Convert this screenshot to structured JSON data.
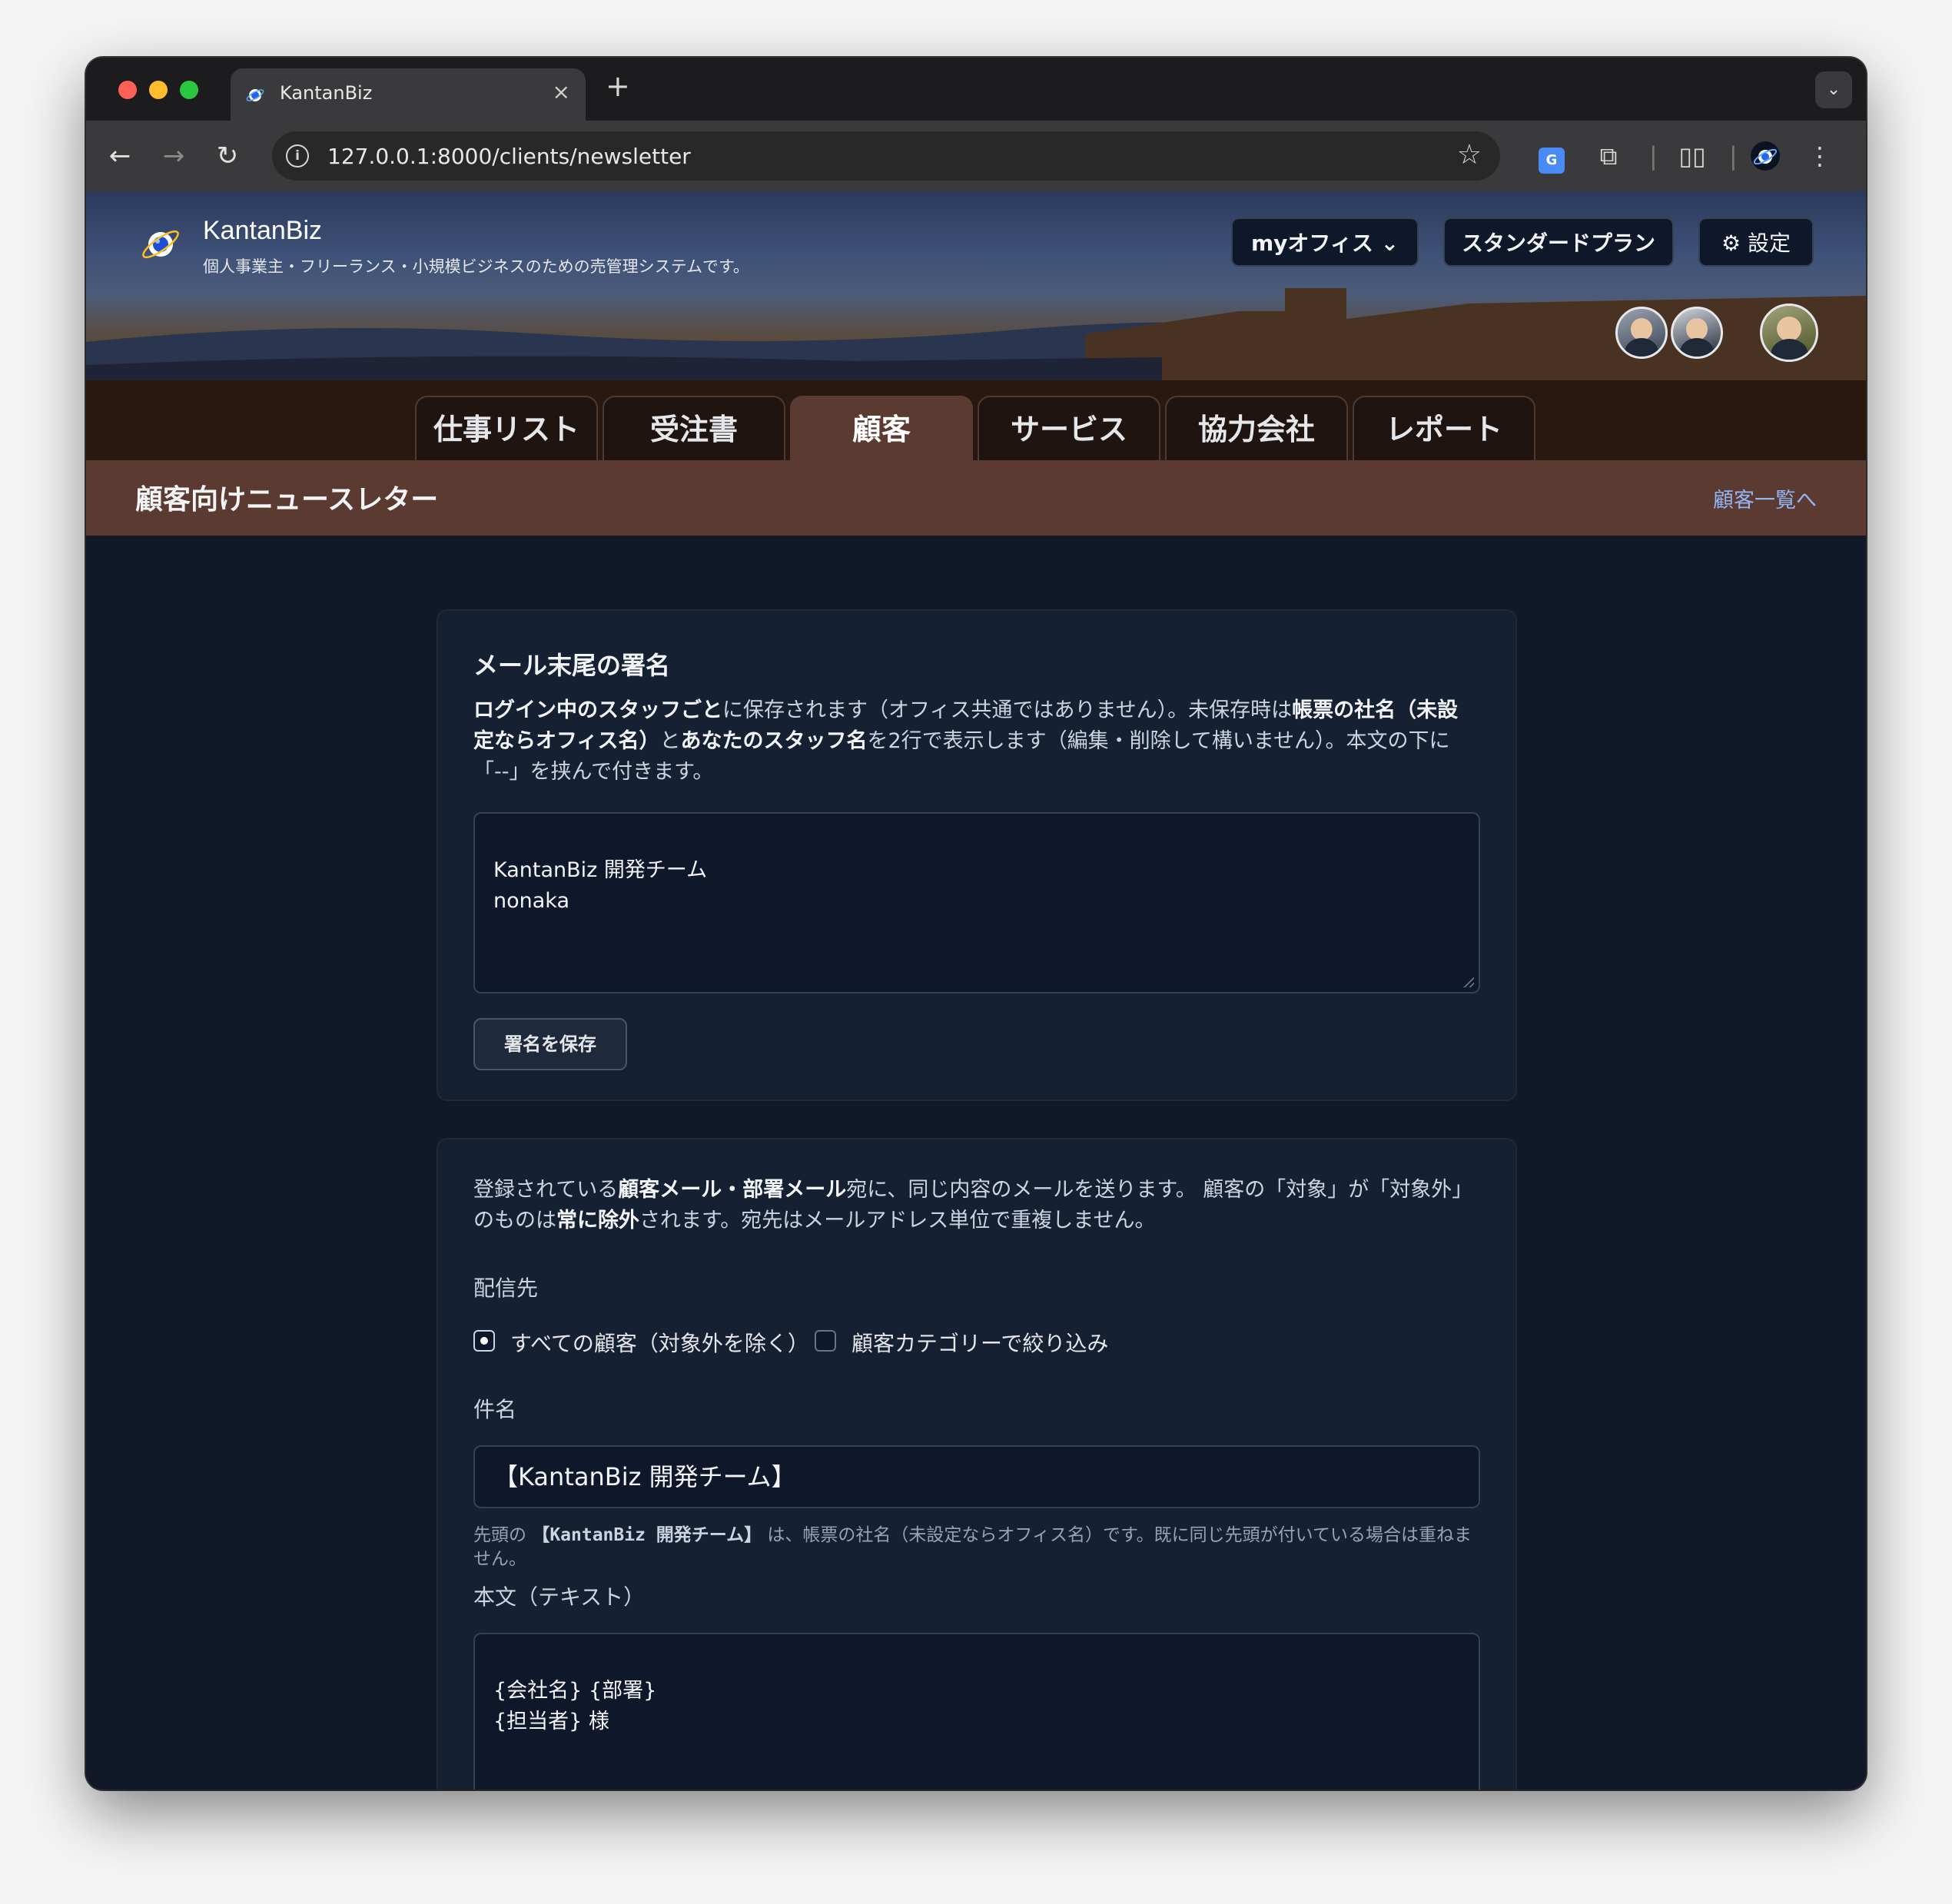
{
  "browser": {
    "tab_title": "KantanBiz",
    "tab_close": "×",
    "new_tab": "+",
    "url": "127.0.0.1:8000/clients/newsletter"
  },
  "header": {
    "brand_name": "KantanBiz",
    "tagline": "個人事業主・フリーランス・小規模ビジネスのための売管理システムです。",
    "office_button": "myオフィス ⌄",
    "plan_button": "スタンダードプラン",
    "settings_button": "⚙ 設定"
  },
  "nav": {
    "tabs": [
      {
        "label": "仕事リスト"
      },
      {
        "label": "受注書"
      },
      {
        "label": "顧客"
      },
      {
        "label": "サービス"
      },
      {
        "label": "協力会社"
      },
      {
        "label": "レポート"
      }
    ],
    "active_tab": "顧客"
  },
  "subheader": {
    "title": "顧客向けニュースレター",
    "back_link": "顧客一覧へ"
  },
  "signature_card": {
    "title": "メール末尾の署名",
    "desc_bold1": "ログイン中のスタッフごと",
    "desc_text1": "に保存されます（オフィス共通ではありません）。未保存時は",
    "desc_bold2": "帳票の社名（未設定ならオフィス名）",
    "desc_text2": "と",
    "desc_bold3": "あなたのスタッフ名",
    "desc_text3": "を2行で表示します（編集・削除して構いません）。本文の下に「--」を挟んで付きます。",
    "signature_value": "KantanBiz 開発チーム\nnonaka",
    "save_button": "署名を保存"
  },
  "newsletter_card": {
    "desc_text1": "登録されている",
    "desc_bold1": "顧客メール・部署メール",
    "desc_text2": "宛に、同じ内容のメールを送ります。 顧客の「対象」が「対象外」のものは",
    "desc_bold2": "常に除外",
    "desc_text3": "されます。宛先はメールアドレス単位で重複しません。",
    "destination_label": "配信先",
    "radio_all": "すべての顧客（対象外を除く）",
    "checkbox_category": "顧客カテゴリーで絞り込み",
    "subject_label": "件名",
    "subject_value": "【KantanBiz 開発チーム】",
    "subject_help_pre": "先頭の",
    "subject_help_code": "【KantanBiz 開発チーム】",
    "subject_help_post": "は、帳票の社名（未設定ならオフィス名）です。既に同じ先頭が付いている場合は重ねません。",
    "body_label": "本文（テキスト）",
    "body_value": "{会社名} {部署}\n{担当者} 様"
  }
}
